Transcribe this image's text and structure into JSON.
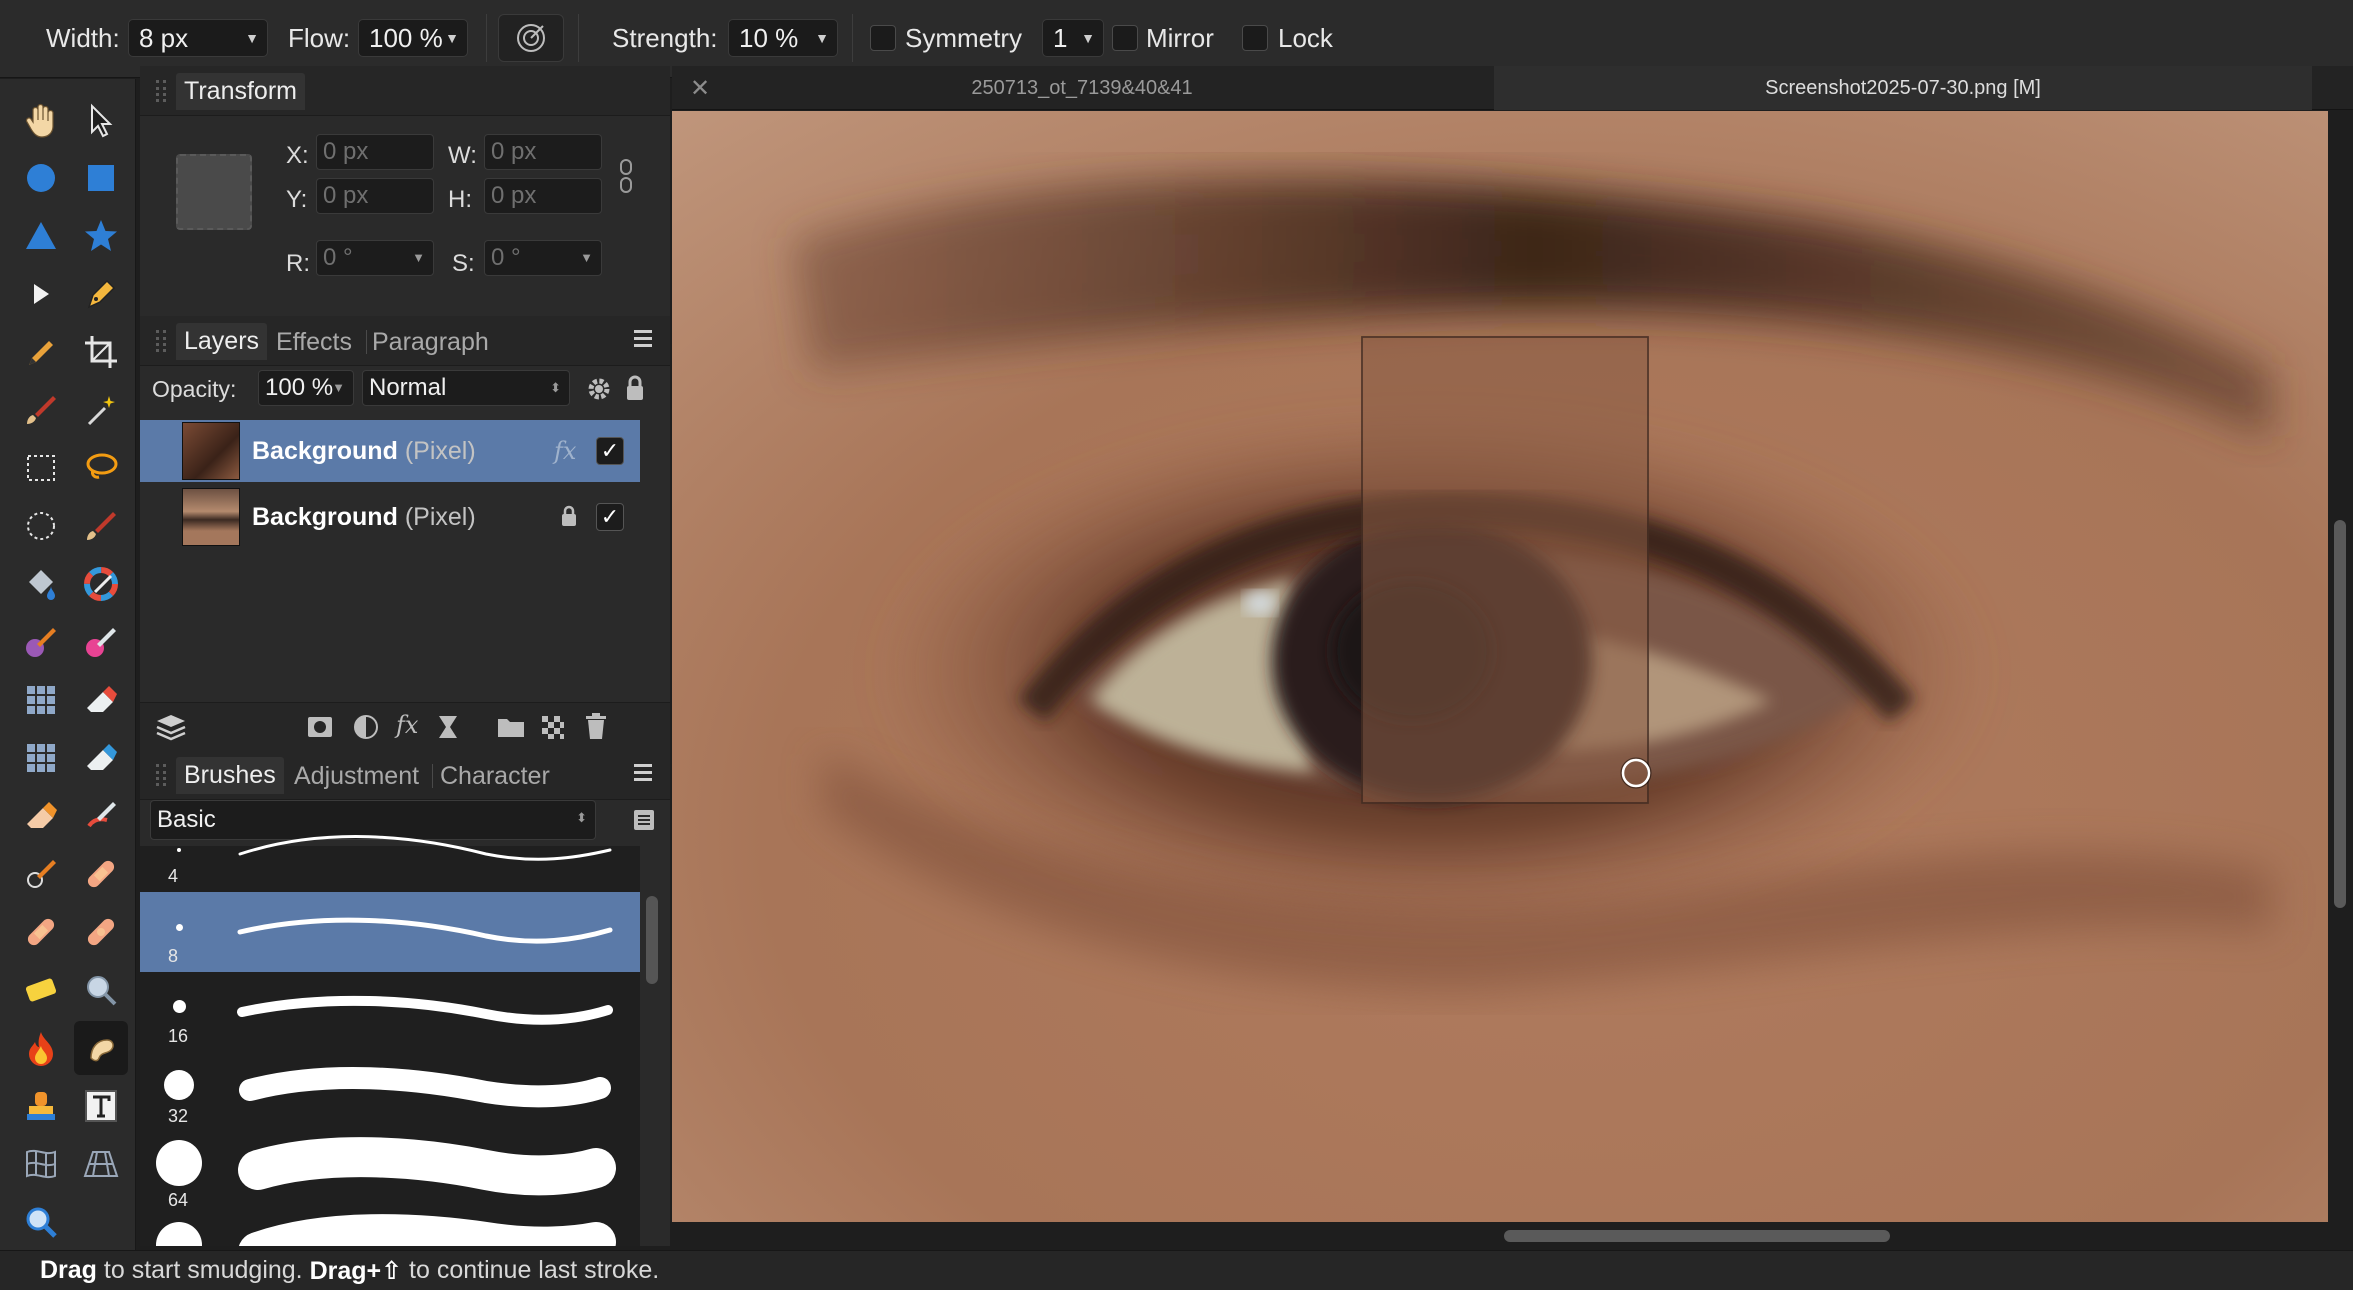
{
  "context_toolbar": {
    "width_label": "Width:",
    "width_value": "8 px",
    "flow_label": "Flow:",
    "flow_value": "100 %",
    "strength_label": "Strength:",
    "strength_value": "10 %",
    "symmetry_label": "Symmetry",
    "symmetry_count": "1",
    "mirror_label": "Mirror",
    "lock_label": "Lock"
  },
  "transform_panel": {
    "tab": "Transform",
    "x_label": "X:",
    "x_value": "0 px",
    "y_label": "Y:",
    "y_value": "0 px",
    "w_label": "W:",
    "w_value": "0 px",
    "h_label": "H:",
    "h_value": "0 px",
    "r_label": "R:",
    "r_value": "0 °",
    "s_label": "S:",
    "s_value": "0 °"
  },
  "layers_panel": {
    "tabs": [
      "Layers",
      "Effects",
      "Paragraph"
    ],
    "opacity_label": "Opacity:",
    "opacity_value": "100 %",
    "blend_mode": "Normal",
    "layers": [
      {
        "name": "Background",
        "kind": "(Pixel)",
        "selected": true,
        "visible": true,
        "fx": "fx"
      },
      {
        "name": "Background",
        "kind": "(Pixel)",
        "selected": false,
        "visible": true,
        "locked": true
      }
    ]
  },
  "brushes_panel": {
    "tabs": [
      "Brushes",
      "Adjustment",
      "Character"
    ],
    "category": "Basic",
    "brushes": [
      {
        "size": "4"
      },
      {
        "size": "8",
        "selected": true
      },
      {
        "size": "16"
      },
      {
        "size": "32"
      },
      {
        "size": "64"
      }
    ]
  },
  "document_tabs": [
    {
      "title": "250713_ot_7139&40&41",
      "active": false
    },
    {
      "title": "Screenshot2025-07-30.png [M]",
      "active": true
    }
  ],
  "status_bar": {
    "drag": "Drag",
    "drag_text": " to start smudging. ",
    "drag_shift": "Drag+⇧",
    "drag_shift_text": " to continue last stroke."
  },
  "colors": {
    "accent": "#5b7aa8",
    "panel_bg": "#2a2a2a",
    "toolbar_bg": "#2b2b2b",
    "tool_blue": "#2e7fd6"
  },
  "tools": [
    "hand-icon",
    "move-arrow-icon",
    "ellipse-icon",
    "rectangle-icon",
    "triangle-icon",
    "star-icon",
    "node-arrow-icon",
    "pen-icon",
    "pencil-icon",
    "crop-icon",
    "paint-brush-icon",
    "magic-wand-icon",
    "rect-marquee-icon",
    "lasso-icon",
    "ellipse-marquee-icon",
    "brush-icon",
    "fill-bucket-icon",
    "color-wheel-icon",
    "color-brush-icon",
    "color-brush-2-icon",
    "pixel-grid-icon",
    "erase-icon",
    "pixel-grid-2-icon",
    "erase-2-icon",
    "eraser-icon",
    "smudge-brush-icon",
    "clone-icon",
    "bandage-icon",
    "bandage-2-icon",
    "bandage-3-icon",
    "sponge-icon",
    "zoom-red-eye-icon",
    "burn-icon",
    "smudge-icon",
    "stamp-icon",
    "text-icon",
    "mesh-warp-icon",
    "perspective-icon",
    "zoom-icon"
  ]
}
